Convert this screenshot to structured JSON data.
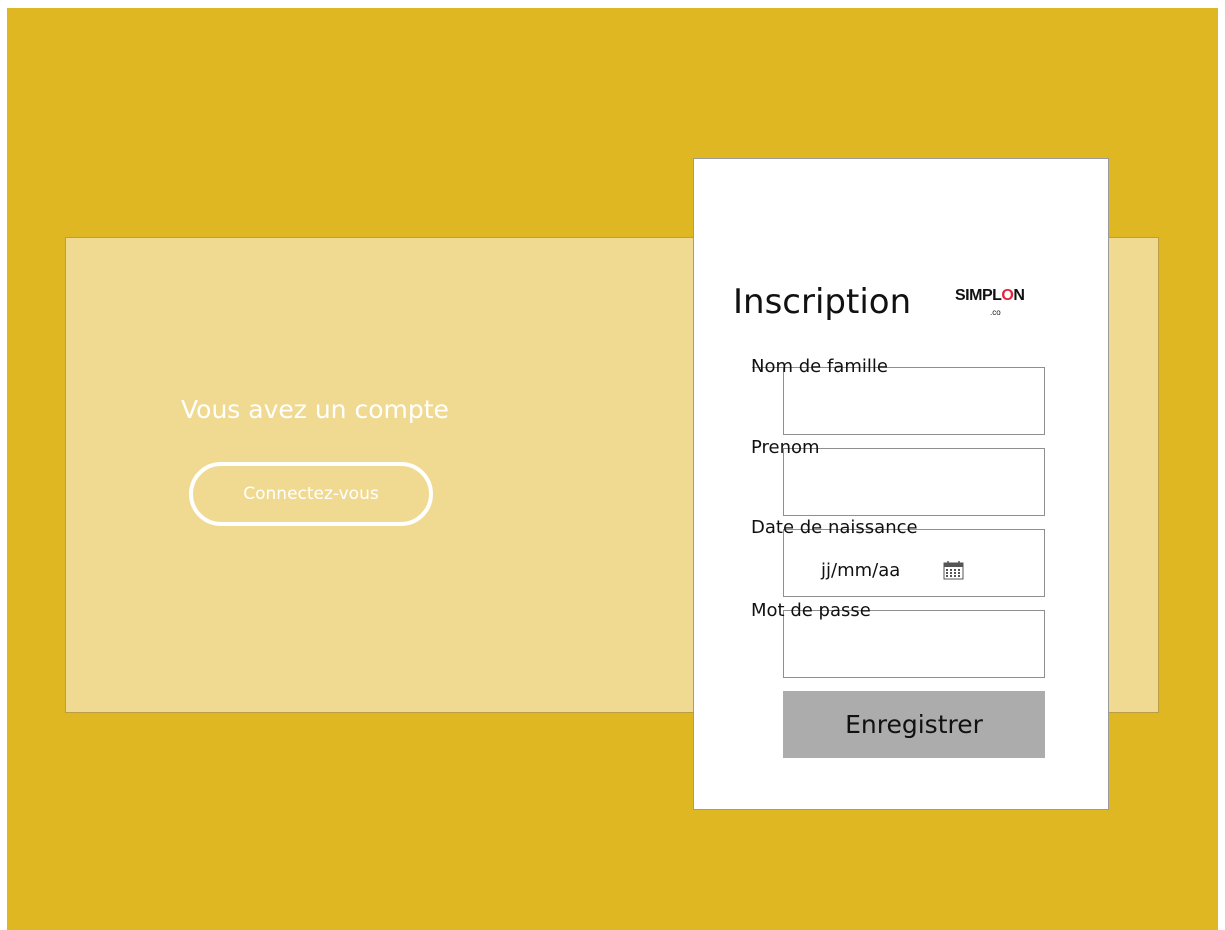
{
  "left_panel": {
    "account_text": "Vous avez un compte",
    "connect_label": "Connectez-vous"
  },
  "form": {
    "title": "Inscription",
    "logo": {
      "main_prefix": "SIMPL",
      "main_o": "O",
      "main_suffix": "N",
      "sub": ".co"
    },
    "fields": {
      "nom": {
        "label": "Nom de famille",
        "value": ""
      },
      "prenom": {
        "label": "Prenom",
        "value": ""
      },
      "date": {
        "label": "Date de naissance",
        "value": "jj/mm/aa"
      },
      "password": {
        "label": "Mot de passe",
        "value": ""
      }
    },
    "submit_label": "Enregistrer"
  },
  "colors": {
    "background": "#dfb722",
    "panel": "#f0da92",
    "card": "#ffffff",
    "submit": "#acacac",
    "logo_accent": "#e0263a"
  },
  "icons": {
    "calendar": "calendar-icon",
    "logo_mark": "power-icon"
  }
}
